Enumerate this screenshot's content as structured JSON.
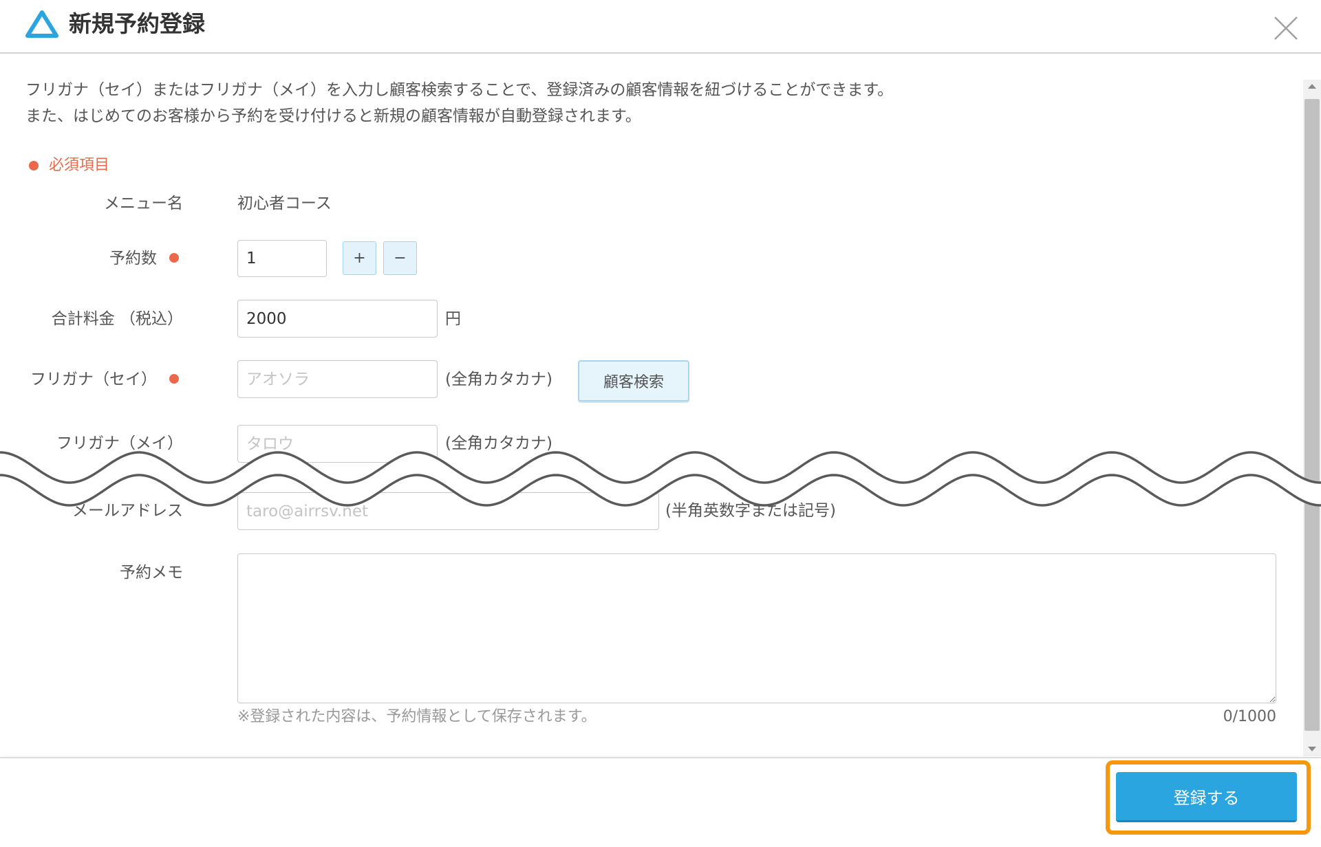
{
  "dialog": {
    "title": "新規予約登録"
  },
  "intro": {
    "lines": [
      "フリガナ（セイ）またはフリガナ（メイ）を入力し顧客検索することで、登録済みの顧客情報を紐づけることができます。",
      "また、はじめてのお客様から予約を受け付けると新規の顧客情報が自動登録されます。"
    ]
  },
  "required_legend": {
    "label": "必須項目"
  },
  "form": {
    "menu_name": {
      "label": "メニュー名",
      "value": "初心者コース"
    },
    "reservation_count": {
      "label": "予約数",
      "required": true,
      "value": "1",
      "increment_label": "+",
      "decrement_label": "−"
    },
    "total_price": {
      "label": "合計料金 （税込）",
      "required": false,
      "value": "2000",
      "unit": "円"
    },
    "furigana_sei": {
      "label": "フリガナ（セイ）",
      "required": true,
      "placeholder": "アオソラ",
      "hint": "(全角カタカナ)",
      "search_button": "顧客検索"
    },
    "furigana_mei": {
      "label": "フリガナ（メイ）",
      "required": false,
      "placeholder": "タロウ",
      "hint": "(全角カタカナ)"
    },
    "email": {
      "label": "メールアドレス",
      "required": false,
      "placeholder": "taro@airrsv.net",
      "hint": "(半角英数字または記号)"
    },
    "memo": {
      "label": "予約メモ",
      "value": "",
      "note": "※登録された内容は、予約情報として保存されます。",
      "counter": "0/1000"
    }
  },
  "footer": {
    "submit_label": "登録する",
    "submit_highlighted": true
  },
  "colors": {
    "accent": "#2ba5e0",
    "required": "#e9694a",
    "highlight": "#f5980f",
    "text": "#555555"
  },
  "icons": {
    "logo": "triangle-logo-icon",
    "close": "close-icon",
    "scroll_up": "scroll-up-arrow-icon",
    "scroll_down": "scroll-down-arrow-icon",
    "required": "required-dot-icon"
  }
}
